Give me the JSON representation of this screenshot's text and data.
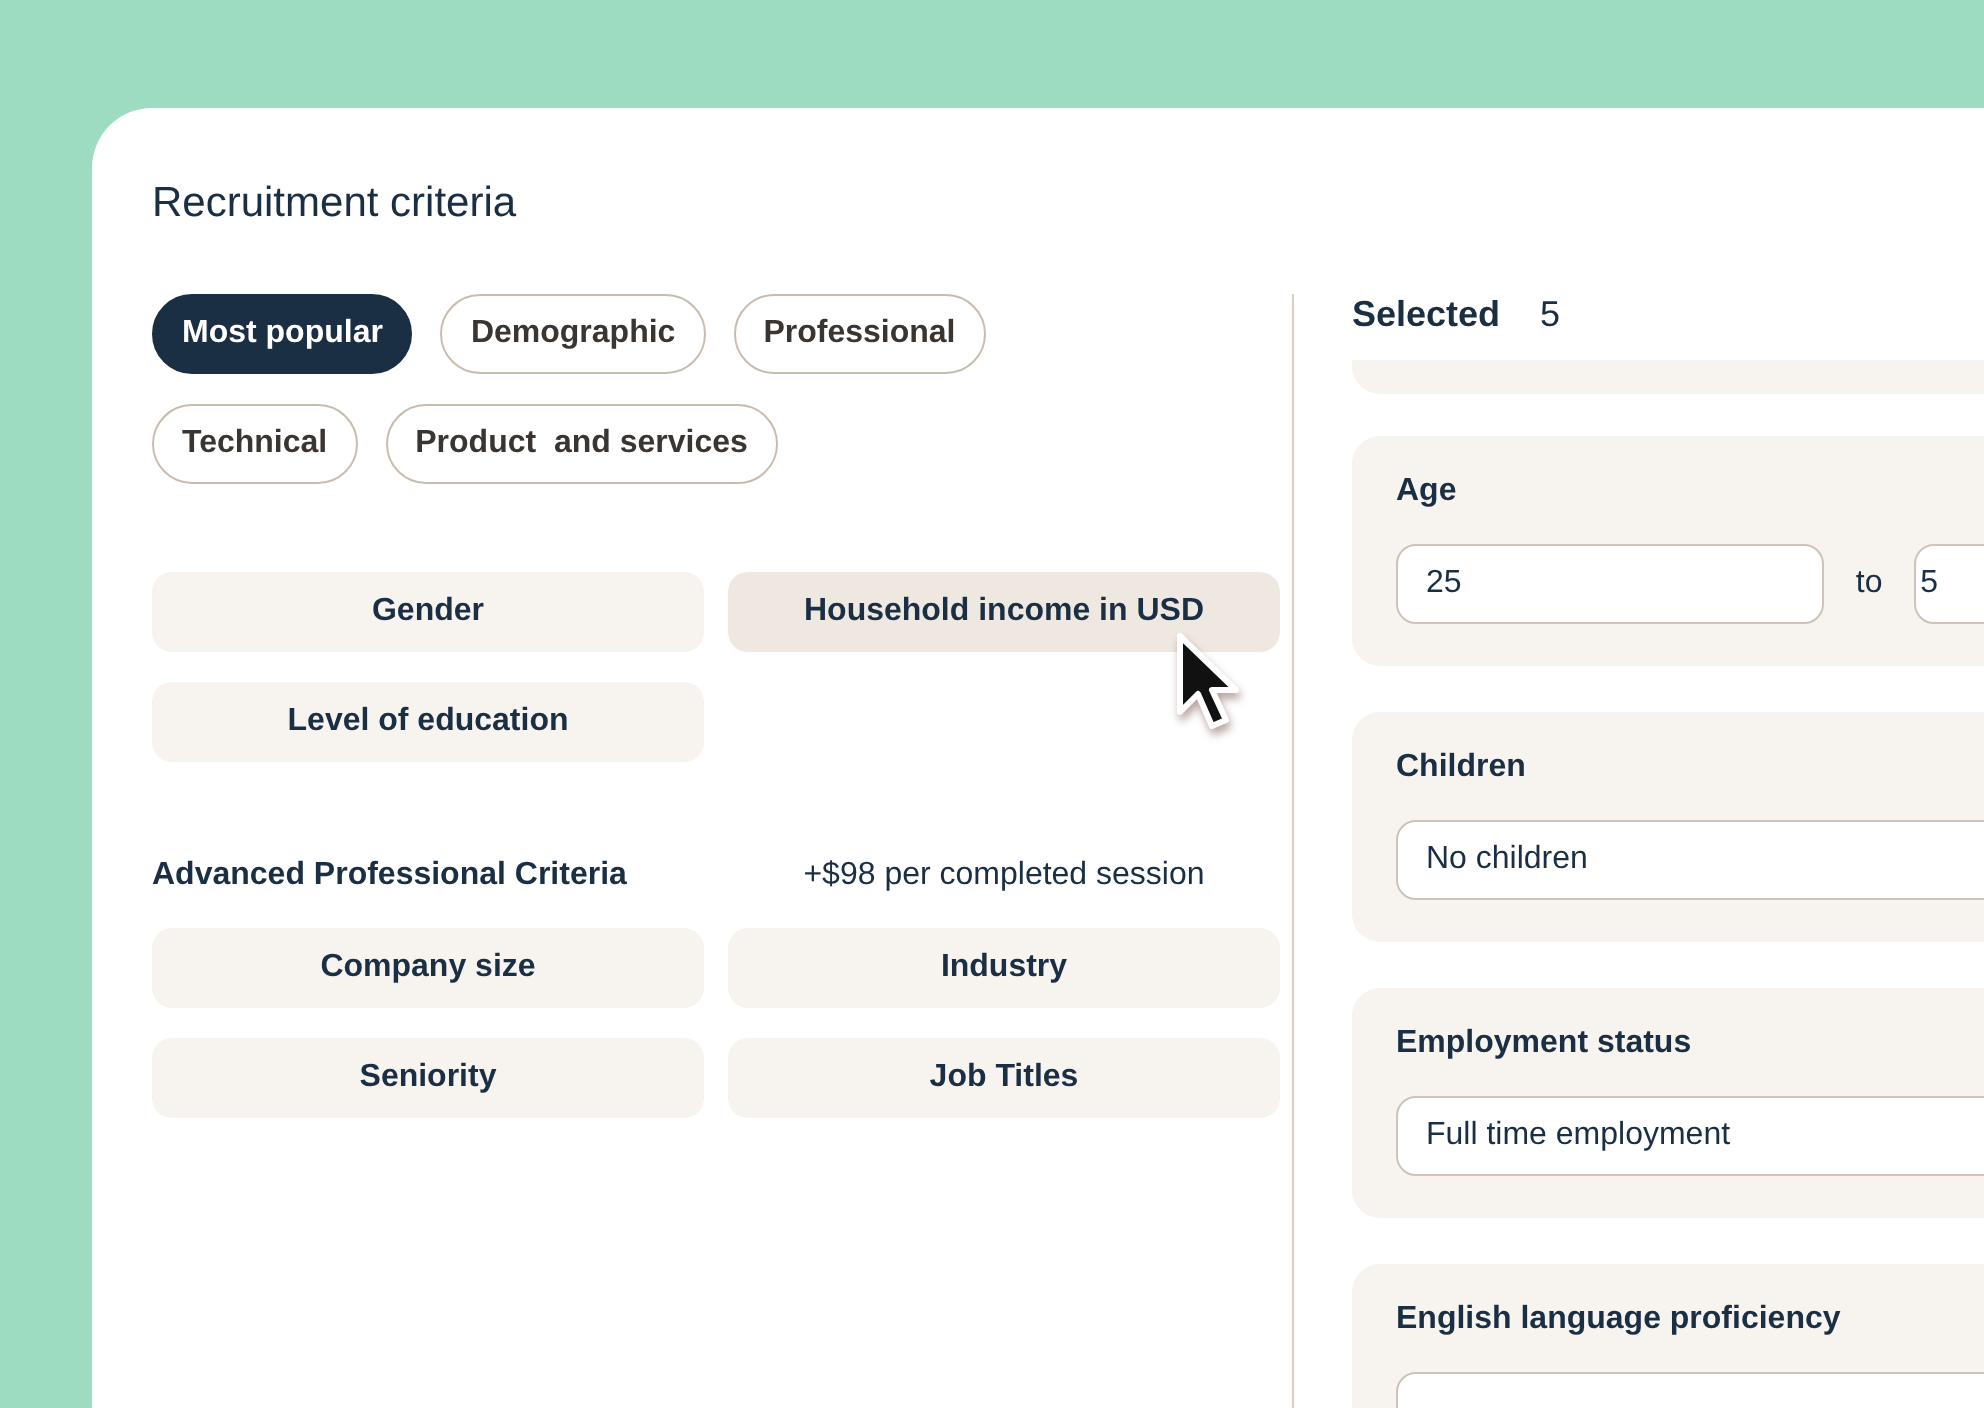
{
  "title": "Recruitment criteria",
  "category_tabs": [
    {
      "label": "Most popular",
      "selected": true
    },
    {
      "label": "Demographic",
      "selected": false
    },
    {
      "label": "Professional",
      "selected": false
    },
    {
      "label": "Technical",
      "selected": false
    },
    {
      "label": "Product  and services",
      "selected": false
    }
  ],
  "criteria": [
    {
      "label": "Gender",
      "hovered": false
    },
    {
      "label": "Household income in USD",
      "hovered": true
    },
    {
      "label": "Level of education",
      "hovered": false
    }
  ],
  "advanced": {
    "title": "Advanced Professional Criteria",
    "price_note": "+$98 per completed session",
    "criteria": [
      {
        "label": "Company size",
        "hovered": false
      },
      {
        "label": "Industry",
        "hovered": false
      },
      {
        "label": "Seniority",
        "hovered": false
      },
      {
        "label": "Job Titles",
        "hovered": false
      }
    ]
  },
  "selected_panel": {
    "label": "Selected",
    "count": "5",
    "filters": [
      {
        "kind": "range",
        "label": "Age",
        "from": "25",
        "connector": "to",
        "to": "5"
      },
      {
        "kind": "select",
        "label": "Children",
        "value": "No children"
      },
      {
        "kind": "select",
        "label": "Employment status",
        "value": "Full time employment"
      },
      {
        "kind": "select",
        "label": "English language proficiency"
      }
    ]
  }
}
